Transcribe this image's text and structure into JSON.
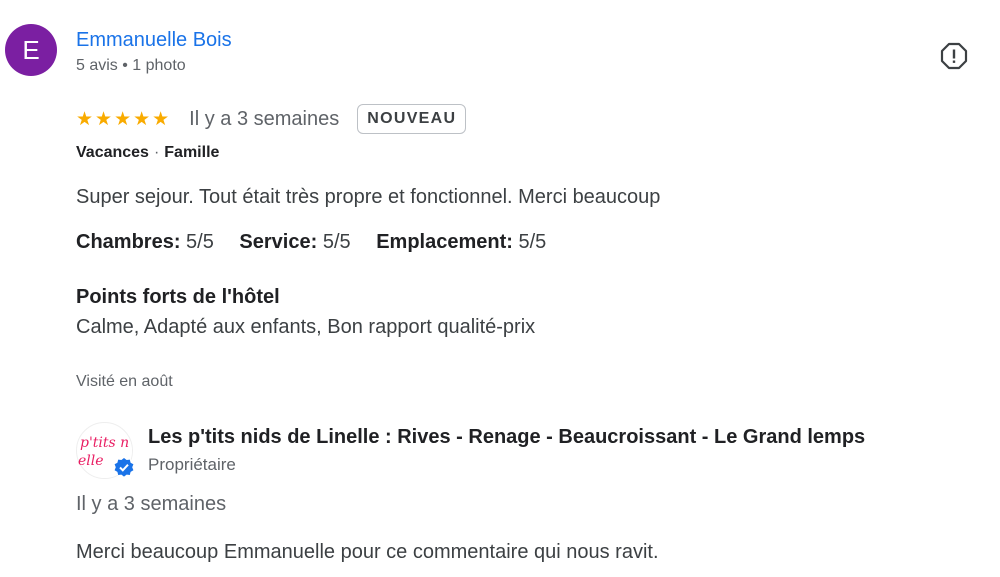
{
  "reviewer": {
    "initial": "E",
    "name": "Emmanuelle Bois",
    "meta": "5 avis • 1 photo",
    "avatar_color": "#7b1fa2"
  },
  "review": {
    "stars": "★★★★★",
    "rating": 5,
    "time": "Il y a 3 semaines",
    "badge": "NOUVEAU",
    "trip_type": "Vacances",
    "trip_group": "Famille",
    "text": "Super sejour. Tout était très propre et fonctionnel. Merci beaucoup",
    "ratings": [
      {
        "label": "Chambres",
        "value": "5/5"
      },
      {
        "label": "Service",
        "value": "5/5"
      },
      {
        "label": "Emplacement",
        "value": "5/5"
      }
    ],
    "highlights_title": "Points forts de l'hôtel",
    "highlights": "Calme, Adapté aux enfants, Bon rapport qualité-prix",
    "visited": "Visité en août",
    "report_icon": "report-icon"
  },
  "owner_reply": {
    "name": "Les p'tits nids de Linelle : Rives - Renage - Beaucroissant - Le Grand lemps",
    "role": "Propriétaire",
    "time": "Il y a 3 semaines",
    "text": "Merci beaucoup Emmanuelle pour ce commentaire qui nous ravit.",
    "logo_text": "p'tits nids de Linelle",
    "verified_color": "#1a73e8"
  },
  "colors": {
    "link": "#1a73e8",
    "star": "#f9ab00"
  }
}
